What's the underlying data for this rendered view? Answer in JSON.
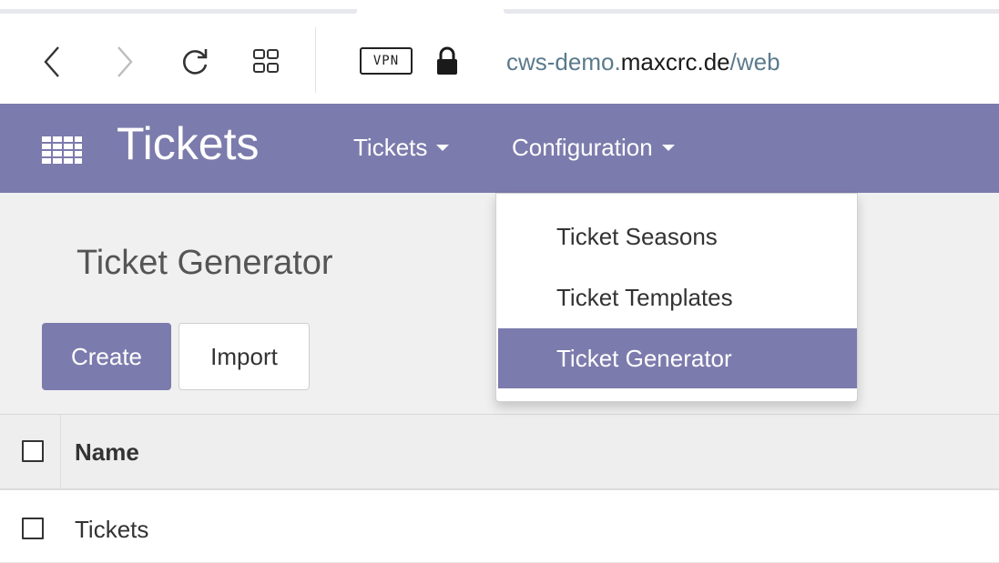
{
  "browser": {
    "vpn_label": "VPN",
    "url": {
      "prefix": "cws-demo.",
      "host": "maxcrc.de",
      "path": "/web"
    }
  },
  "navbar": {
    "app_title": "Tickets",
    "menus": [
      {
        "label": "Tickets"
      },
      {
        "label": "Configuration"
      }
    ]
  },
  "dropdown": {
    "items": [
      {
        "label": "Ticket Seasons"
      },
      {
        "label": "Ticket Templates"
      },
      {
        "label": "Ticket Generator",
        "active": true
      }
    ]
  },
  "control_panel": {
    "title": "Ticket Generator",
    "create_label": "Create",
    "import_label": "Import"
  },
  "list": {
    "columns": [
      "Name"
    ],
    "rows": [
      {
        "name": "Tickets"
      }
    ]
  },
  "colors": {
    "brand": "#7c7bad",
    "control_panel_bg": "#f0f0f0",
    "url_muted": "#5a7a8c"
  },
  "icons": [
    "back-icon",
    "forward-icon",
    "reload-icon",
    "tab-grid-icon",
    "lock-icon",
    "apps-grid-icon",
    "caret-down-icon",
    "checkbox-icon"
  ]
}
